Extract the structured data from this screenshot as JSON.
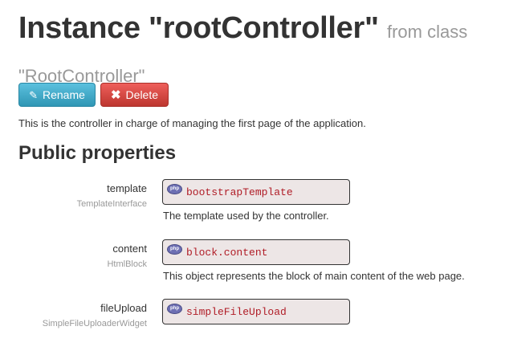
{
  "header": {
    "title": "Instance \"rootController\"",
    "subtitle": "from class \"RootController\""
  },
  "buttons": {
    "rename_label": "Rename",
    "delete_label": "Delete"
  },
  "description": "This is the controller in charge of managing the first page of the application.",
  "section_title": "Public properties",
  "properties": [
    {
      "name": "template",
      "type": "TemplateInterface",
      "value": "bootstrapTemplate",
      "description": "The template used by the controller."
    },
    {
      "name": "content",
      "type": "HtmlBlock",
      "value": "block.content",
      "description": "This object represents the block of main content of the web page."
    },
    {
      "name": "fileUpload",
      "type": "SimpleFileUploaderWidget",
      "value": "simpleFileUpload",
      "description": ""
    }
  ],
  "badge_text": "php",
  "colors": {
    "rename": "#2f96b4",
    "delete": "#bd362f",
    "value_bg": "#ede6e6",
    "code_text": "#b01c26"
  },
  "icons": {
    "rename": "pencil-icon",
    "delete": "close-icon",
    "value": "php-icon"
  }
}
